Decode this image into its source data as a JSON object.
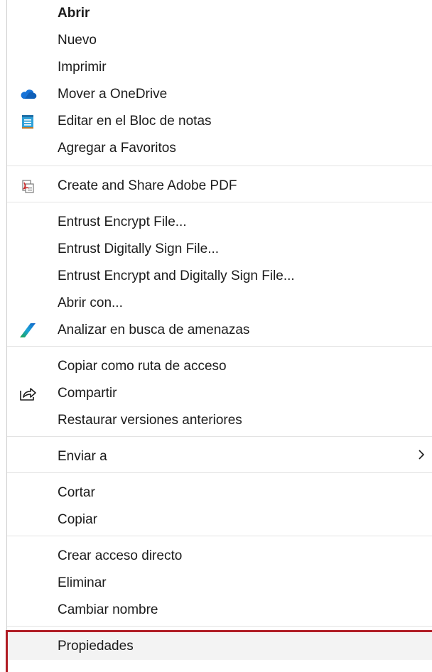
{
  "menu": {
    "items": [
      {
        "id": "abrir",
        "label": "Abrir"
      },
      {
        "id": "nuevo",
        "label": "Nuevo"
      },
      {
        "id": "imprimir",
        "label": "Imprimir"
      },
      {
        "id": "onedrive",
        "label": "Mover a OneDrive",
        "icon": "onedrive-cloud-icon"
      },
      {
        "id": "notepad",
        "label": "Editar en el Bloc de notas",
        "icon": "notepad-icon"
      },
      {
        "id": "favoritos",
        "label": "Agregar a Favoritos"
      },
      {
        "id": "adobe",
        "label": "Create and Share Adobe PDF",
        "icon": "adobe-pdf-icon"
      },
      {
        "id": "encrypt",
        "label": "Entrust Encrypt File..."
      },
      {
        "id": "sign",
        "label": "Entrust Digitally Sign File..."
      },
      {
        "id": "encrypt_sign",
        "label": "Entrust Encrypt and Digitally Sign File..."
      },
      {
        "id": "abrir_con",
        "label": "Abrir con..."
      },
      {
        "id": "analizar",
        "label": "Analizar en busca de amenazas",
        "icon": "defender-scan-icon"
      },
      {
        "id": "copiar_ruta",
        "label": "Copiar como ruta de acceso"
      },
      {
        "id": "compartir",
        "label": "Compartir",
        "icon": "share-icon"
      },
      {
        "id": "restaurar",
        "label": "Restaurar versiones anteriores"
      },
      {
        "id": "enviar_a",
        "label": "Enviar a",
        "icon": "chevron-right-icon"
      },
      {
        "id": "cortar",
        "label": "Cortar"
      },
      {
        "id": "copiar",
        "label": "Copiar"
      },
      {
        "id": "crear_acceso",
        "label": "Crear acceso directo"
      },
      {
        "id": "eliminar",
        "label": "Eliminar"
      },
      {
        "id": "cambiar_nombre",
        "label": "Cambiar nombre"
      },
      {
        "id": "propiedades",
        "label": "Propiedades",
        "state": "highlighted"
      }
    ]
  },
  "colors": {
    "highlight_border": "#b01c24",
    "highlight_background": "#f3f3f3",
    "separator": "#e3e3e3",
    "text": "#1b1b1b"
  }
}
